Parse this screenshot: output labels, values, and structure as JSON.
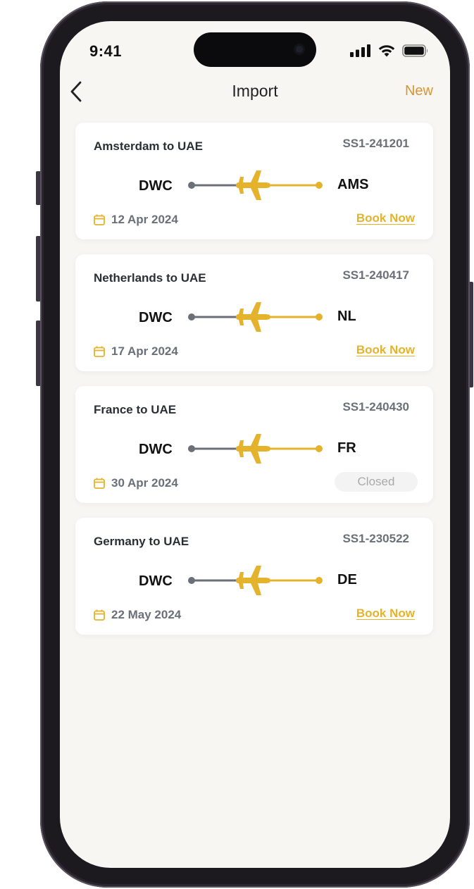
{
  "status_bar": {
    "time": "9:41"
  },
  "nav": {
    "back_icon": "chevron-left-icon",
    "title": "Import",
    "new_label": "New"
  },
  "colors": {
    "accent": "#d99532",
    "plane": "#e4b32b",
    "route_gray": "#6b6f78",
    "background": "#f8f6f3"
  },
  "cards": [
    {
      "title": "Amsterdam to UAE",
      "ref": "SS1-241201",
      "from": "DWC",
      "to": "AMS",
      "date": "12 Apr 2024",
      "action": "Book Now"
    },
    {
      "title": "Netherlands to UAE",
      "ref": "SS1-240417",
      "from": "DWC",
      "to": "NL",
      "date": "17 Apr 2024",
      "action": "Book Now"
    },
    {
      "title": "France to UAE",
      "ref": "SS1-240430",
      "from": "DWC",
      "to": "FR",
      "date": "30 Apr 2024",
      "status": "Closed"
    },
    {
      "title": "Germany to UAE",
      "ref": "SS1-230522",
      "from": "DWC",
      "to": "DE",
      "date": "22 May 2024",
      "action": "Book Now"
    }
  ]
}
